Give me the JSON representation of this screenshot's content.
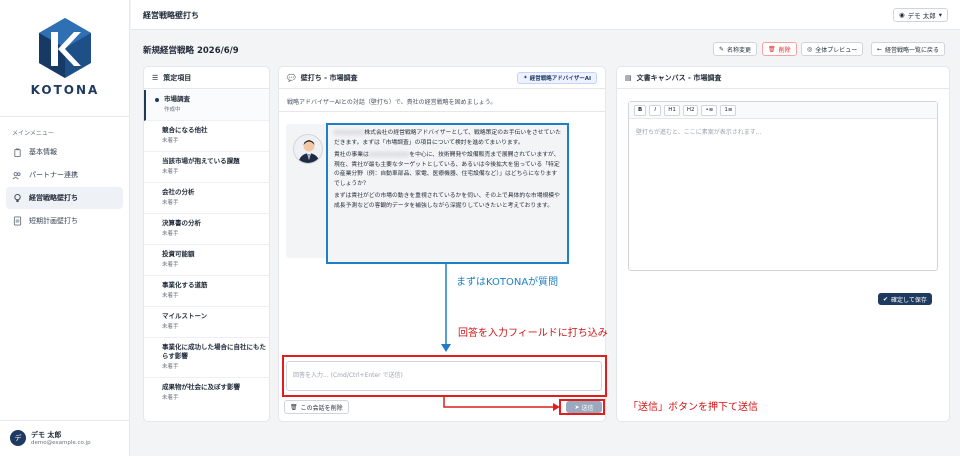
{
  "sidebar": {
    "logo_text": "KOTONA",
    "menu_heading": "メインメニュー",
    "items": [
      {
        "label": "基本情報",
        "icon": "clipboard-icon"
      },
      {
        "label": "パートナー連携",
        "icon": "users-icon"
      },
      {
        "label": "経営戦略壁打ち",
        "icon": "lightbulb-icon",
        "active": true
      },
      {
        "label": "短期計画壁打ち",
        "icon": "document-icon"
      }
    ],
    "user": {
      "name": "デモ 太郎",
      "email": "demo@example.co.jp"
    }
  },
  "topbar": {
    "title": "経営戦略壁打ち",
    "user_label": "デモ 太郎"
  },
  "page": {
    "title": "新規経営戦略 2026/6/9",
    "buttons": {
      "rename": "名称変更",
      "delete": "削除",
      "preview": "全体プレビュー",
      "back": "経営戦略一覧に戻る"
    }
  },
  "items_panel": {
    "title": "策定項目",
    "items": [
      {
        "name": "市場調査",
        "status": "作成中"
      },
      {
        "name": "競合になる他社",
        "status": "未着手"
      },
      {
        "name": "当該市場が抱えている課題",
        "status": "未着手"
      },
      {
        "name": "会社の分析",
        "status": "未着手"
      },
      {
        "name": "決算書の分析",
        "status": "未着手"
      },
      {
        "name": "投資可能額",
        "status": "未着手"
      },
      {
        "name": "事業化する道筋",
        "status": "未着手"
      },
      {
        "name": "マイルストーン",
        "status": "未着手"
      },
      {
        "name": "事業化に成功した場合に自社にもたらす影響",
        "status": "未着手"
      },
      {
        "name": "成果物が社会に及ぼす影響",
        "status": "未着手"
      }
    ]
  },
  "chat": {
    "title": "壁打ち - 市場調査",
    "badge": "経営戦略アドバイザーAI",
    "intro": "戦略アドバイザーAIとの対話（壁打ち）で、貴社の経営戦略を固めましょう。",
    "message": {
      "p1_blur": "○○○○○○",
      "p1": "株式会社の経営戦略アドバイザーとして、戦略策定のお手伝いをさせていただきます。まずは「市場調査」の項目について検討を進めてまいります。",
      "p2_pre": "貴社の事業は",
      "p2_blur": "○○○○○○○○",
      "p2": "を中心に、技術開発や設備販売まで展開されていますが、現在、貴社が最も主要なターゲットとしている、あるいは今後拡大を狙っている「特定の産業分野（例：自動車部品、家電、医療機器、住宅設備など）」はどちらになりますでしょうか？",
      "p3": "まずは貴社がどの市場の動きを重視されているかを伺い、その上で具体的な市場規模や成長予測などの客観的データを補強しながら深掘りしていきたいと考えております。"
    },
    "input_placeholder": "回答を入力... (Cmd/Ctrl+Enter で送信)",
    "clear_label": "この会話を削除",
    "send_label": "送信"
  },
  "canvas": {
    "title": "文書キャンバス - 市場調査",
    "toolbar": [
      "B",
      "I",
      "H1",
      "H2",
      "•≡",
      "1≡"
    ],
    "placeholder": "壁打ちが進むと、ここに素案が表示されます...",
    "save_label": "確定して保存"
  },
  "annotations": {
    "first": "まずはKOTONAが質問",
    "second": "回答を入力フィールドに打ち込み",
    "third": "「送信」ボタンを押下て送信"
  },
  "colors": {
    "brand": "#1e3a5f",
    "annotation_blue": "#1f7fc4",
    "annotation_red": "#e11d1d"
  }
}
